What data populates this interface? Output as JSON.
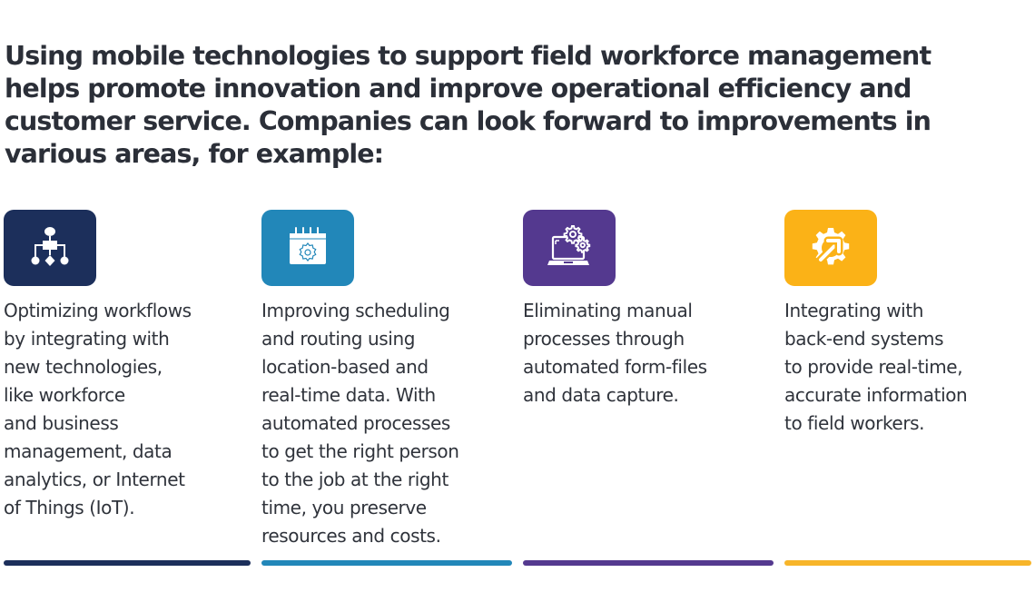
{
  "heading": "Using mobile technologies to support field workforce management\nhelps promote innovation and improve operational efficiency and\ncustomer service. Companies can look forward to improvements in\nvarious areas, for example:",
  "items": [
    {
      "icon": "workflow-diagram-icon",
      "color": "#1c2f5b",
      "text": "Optimizing workflows\nby integrating with\nnew technologies,\nlike workforce\nand business\nmanagement, data\nanalytics, or Internet\nof Things (IoT)."
    },
    {
      "icon": "calendar-gear-icon",
      "color": "#2287b9",
      "text": "Improving scheduling\nand routing using\nlocation-based and\nreal-time data. With\nautomated processes\nto get the right person\nto the job at the right\ntime, you preserve\nresources and costs."
    },
    {
      "icon": "laptop-gears-icon",
      "color": "#54398f",
      "text": "Eliminating manual\nprocesses through\nautomated form-files\nand data capture."
    },
    {
      "icon": "gear-arrow-icon",
      "color": "#fbb217",
      "text": "Integrating with\nback-end systems\nto provide real-time,\naccurate information\nto field workers."
    }
  ]
}
